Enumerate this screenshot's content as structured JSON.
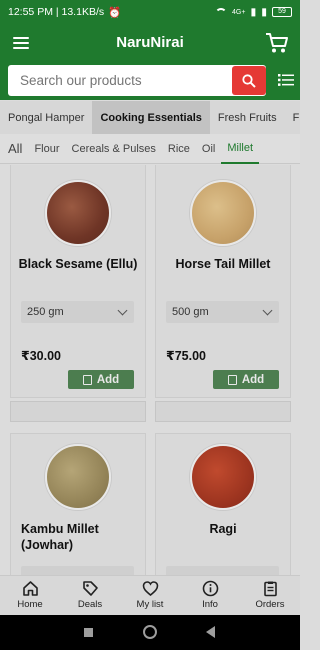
{
  "status_bar": {
    "time_speed": "12:55 PM | 13.1KB/s",
    "battery": "59",
    "signal": "4G+"
  },
  "app": {
    "title": "NaruNirai"
  },
  "search": {
    "placeholder": "Search our products"
  },
  "category_tabs": [
    "Pongal Hamper",
    "Cooking Essentials",
    "Fresh Fruits",
    "Fresh V"
  ],
  "sub_tabs": [
    "All",
    "Flour",
    "Cereals & Pulses",
    "Rice",
    "Oil",
    "Millet"
  ],
  "products": [
    {
      "name": "Black Sesame (Ellu)",
      "weight": "250 gm",
      "price": "₹30.00",
      "add": "Add",
      "color": "#7a3e2c"
    },
    {
      "name": "Horse Tail Millet",
      "weight": "500 gm",
      "price": "₹75.00",
      "add": "Add",
      "color": "#c9a571"
    },
    {
      "name": "Kambu Millet (Jowhar)",
      "color": "#9a8a5e"
    },
    {
      "name": "Ragi",
      "color": "#a23a22"
    }
  ],
  "bottom_nav": [
    "Home",
    "Deals",
    "My list",
    "Info",
    "Orders"
  ],
  "colors": {
    "primary_green": "#1f7a2e",
    "search_red": "#e53935",
    "add_green": "#4c7d4f"
  }
}
